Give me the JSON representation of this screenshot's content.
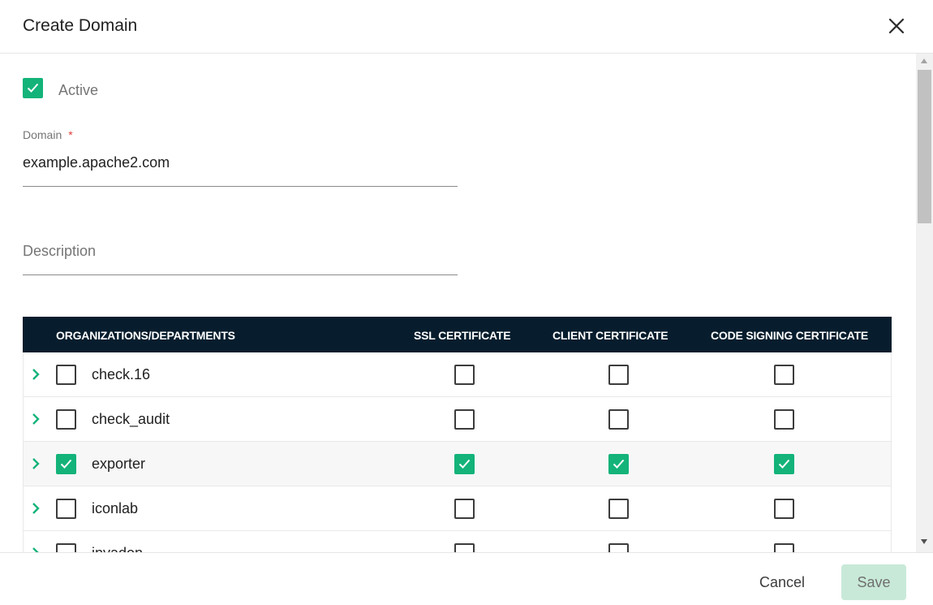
{
  "dialog": {
    "title": "Create Domain",
    "close_icon": "close-icon"
  },
  "form": {
    "active": {
      "label": "Active",
      "checked": true
    },
    "domain": {
      "label": "Domain",
      "required_mark": "*",
      "value": "example.apache2.com"
    },
    "description": {
      "placeholder": "Description",
      "value": ""
    }
  },
  "table": {
    "headers": [
      "ORGANIZATIONS/DEPARTMENTS",
      "SSL CERTIFICATE",
      "CLIENT CERTIFICATE",
      "CODE SIGNING CERTIFICATE"
    ],
    "rows": [
      {
        "name": "check.16",
        "org": false,
        "ssl": false,
        "client": false,
        "code": false
      },
      {
        "name": "check_audit",
        "org": false,
        "ssl": false,
        "client": false,
        "code": false
      },
      {
        "name": "exporter",
        "org": true,
        "ssl": true,
        "client": true,
        "code": true
      },
      {
        "name": "iconlab",
        "org": false,
        "ssl": false,
        "client": false,
        "code": false
      },
      {
        "name": "invadon",
        "org": false,
        "ssl": false,
        "client": false,
        "code": false
      }
    ]
  },
  "footer": {
    "cancel_label": "Cancel",
    "save_label": "Save"
  },
  "colors": {
    "accent": "#13b37a",
    "table_header": "#071d2d",
    "save_disabled": "#c8e9d8",
    "required": "#e0403c"
  }
}
